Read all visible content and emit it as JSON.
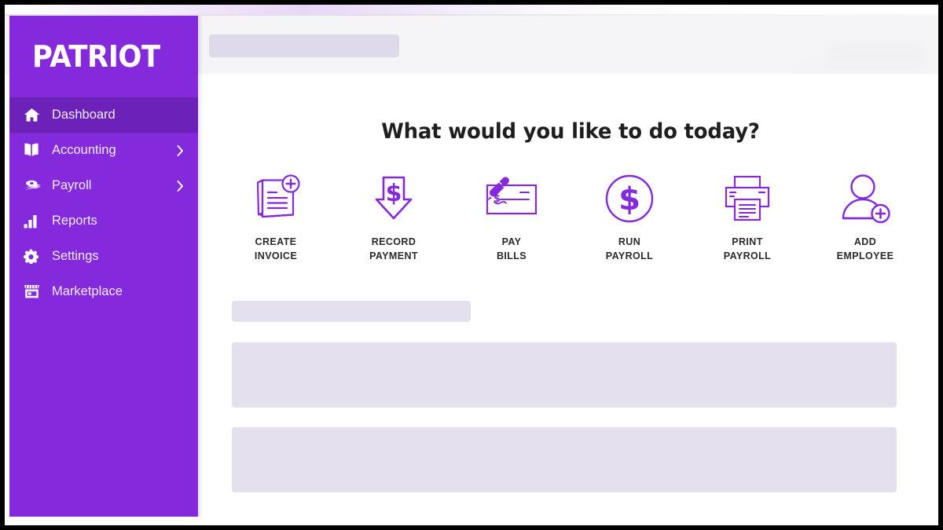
{
  "brand": {
    "logo_text": "PATRIOT",
    "sidebar_color": "#8429dc",
    "sidebar_active_color": "#6c21b8",
    "accent_color": "#8429dc",
    "placeholder_color": "#e4e0ee",
    "heading_color": "#1e1e1e"
  },
  "sidebar": {
    "items": [
      {
        "label": "Dashboard",
        "icon": "home-icon",
        "active": true,
        "has_submenu": false
      },
      {
        "label": "Accounting",
        "icon": "book-icon",
        "active": false,
        "has_submenu": true
      },
      {
        "label": "Payroll",
        "icon": "money-icon",
        "active": false,
        "has_submenu": true
      },
      {
        "label": "Reports",
        "icon": "bar-chart-icon",
        "active": false,
        "has_submenu": false
      },
      {
        "label": "Settings",
        "icon": "gear-icon",
        "active": false,
        "has_submenu": false
      },
      {
        "label": "Marketplace",
        "icon": "storefront-icon",
        "active": false,
        "has_submenu": false
      }
    ],
    "chevron_icon": "chevron-right-icon"
  },
  "header": {
    "redacted_pill": ""
  },
  "main": {
    "heading": "What would you like to do today?",
    "actions": [
      {
        "label_line1": "CREATE",
        "label_line2": "INVOICE",
        "icon": "invoice-add-icon"
      },
      {
        "label_line1": "RECORD",
        "label_line2": "PAYMENT",
        "icon": "arrow-down-dollar-icon"
      },
      {
        "label_line1": "PAY",
        "label_line2": "BILLS",
        "icon": "check-pen-icon"
      },
      {
        "label_line1": "RUN",
        "label_line2": "PAYROLL",
        "icon": "dollar-circle-icon"
      },
      {
        "label_line1": "PRINT",
        "label_line2": "PAYROLL",
        "icon": "printer-icon"
      },
      {
        "label_line1": "ADD",
        "label_line2": "EMPLOYEE",
        "icon": "user-add-icon"
      }
    ],
    "placeholder_blocks": [
      {
        "name": "section-title-placeholder",
        "text": ""
      },
      {
        "name": "widget-placeholder-1",
        "text": ""
      },
      {
        "name": "widget-placeholder-2",
        "text": ""
      }
    ]
  }
}
